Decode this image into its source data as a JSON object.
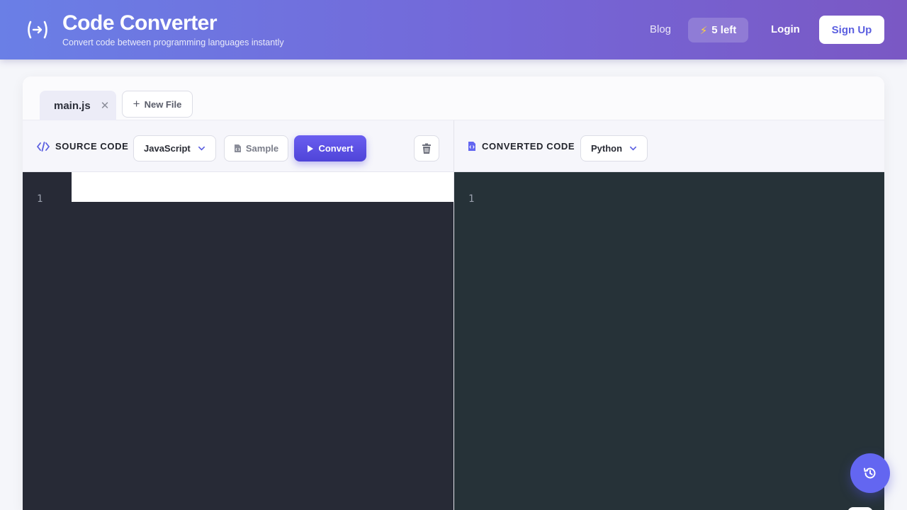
{
  "header": {
    "logo_icon": "code-convert-icon",
    "title": "Code Converter",
    "subtitle": "Convert code between programming languages instantly",
    "nav": {
      "blog": "Blog",
      "credits_icon": "lightning-icon",
      "credits": "5 left",
      "login": "Login",
      "signup": "Sign Up"
    }
  },
  "tabs": {
    "files": [
      {
        "label": "main.js",
        "close_icon": "close-icon"
      }
    ],
    "new_file": "New File"
  },
  "source": {
    "label": "SOURCE CODE",
    "icon": "code-icon",
    "language": "JavaScript",
    "sample": "Sample",
    "convert": "Convert",
    "line_numbers": [
      "1"
    ]
  },
  "target": {
    "label": "CONVERTED CODE",
    "icon": "file-code-icon",
    "language": "Python",
    "line_numbers": [
      "1"
    ]
  },
  "colors": {
    "accent": "#5b5fe0",
    "header_start": "#6a7fe6",
    "header_end": "#7a58c4",
    "source_editor_bg": "#272a36",
    "target_editor_bg": "#263238"
  },
  "fab": {
    "icon": "history-icon"
  }
}
